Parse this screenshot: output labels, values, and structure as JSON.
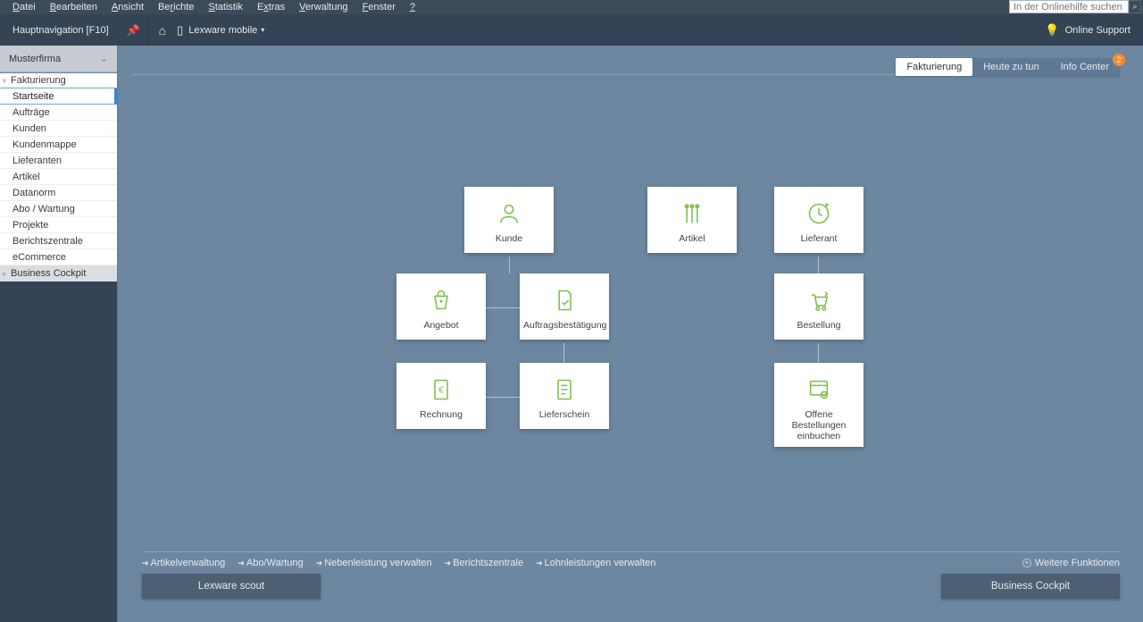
{
  "menubar": {
    "items": [
      "Datei",
      "Bearbeiten",
      "Ansicht",
      "Berichte",
      "Statistik",
      "Extras",
      "Verwaltung",
      "Fenster",
      "?"
    ],
    "search_placeholder": "In der Onlinehilfe suchen"
  },
  "toolbar": {
    "hauptnav": "Hauptnavigation [F10]",
    "lex_mobile": "Lexware mobile",
    "support": "Online Support"
  },
  "sidebar": {
    "company": "Musterfirma",
    "section_active": "Fakturierung",
    "items": [
      "Startseite",
      "Aufträge",
      "Kunden",
      "Kundenmappe",
      "Lieferanten",
      "Artikel",
      "Datanorm",
      "Abo / Wartung",
      "Projekte",
      "Berichtszentrale",
      "eCommerce"
    ],
    "section_other": "Business Cockpit"
  },
  "tabs": {
    "t1": "Fakturierung",
    "t2": "Heute zu tun",
    "t3": "Info Center",
    "badge": "2"
  },
  "tiles": {
    "kunde": "Kunde",
    "artikel": "Artikel",
    "lieferant": "Lieferant",
    "angebot": "Angebot",
    "auftragsbest": "Auftragsbestätigung",
    "bestellung": "Bestellung",
    "rechnung": "Rechnung",
    "lieferschein": "Lieferschein",
    "offene_best": "Offene Bestellungen einbuchen"
  },
  "quicklinks": {
    "l1": "Artikelverwaltung",
    "l2": "Abo/Wartung",
    "l3": "Nebenleistung verwalten",
    "l4": "Berichtszentrale",
    "l5": "Lohnleistungen verwalten",
    "more": "Weitere Funktionen"
  },
  "buttons": {
    "scout": "Lexware scout",
    "cockpit": "Business Cockpit"
  }
}
